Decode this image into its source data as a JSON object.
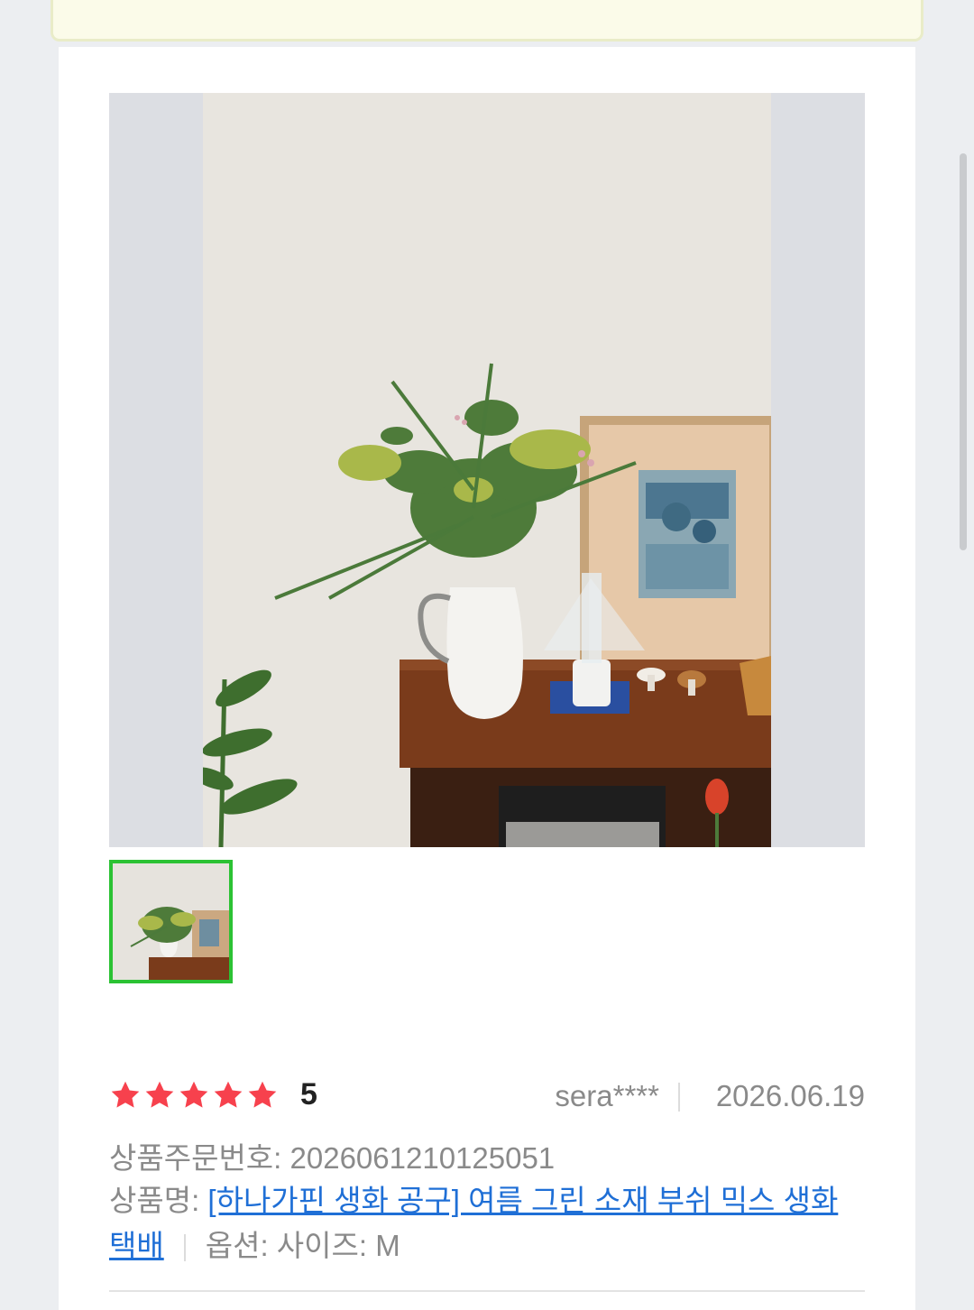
{
  "review": {
    "rating_value": "5",
    "rating_stars": 5,
    "author": "sera****",
    "date": "2026.06.19",
    "order_label": "상품주문번호:",
    "order_number": "2026061210125051",
    "product_label": "상품명:",
    "product_name": "[하나가핀 생화 공구] 여름 그린 소재 부쉬 믹스 생화 택배",
    "option_text": "옵션: 사이즈: M"
  },
  "colors": {
    "star": "#f7414d",
    "link": "#1f6fd6",
    "thumb_border": "#2bc233"
  }
}
